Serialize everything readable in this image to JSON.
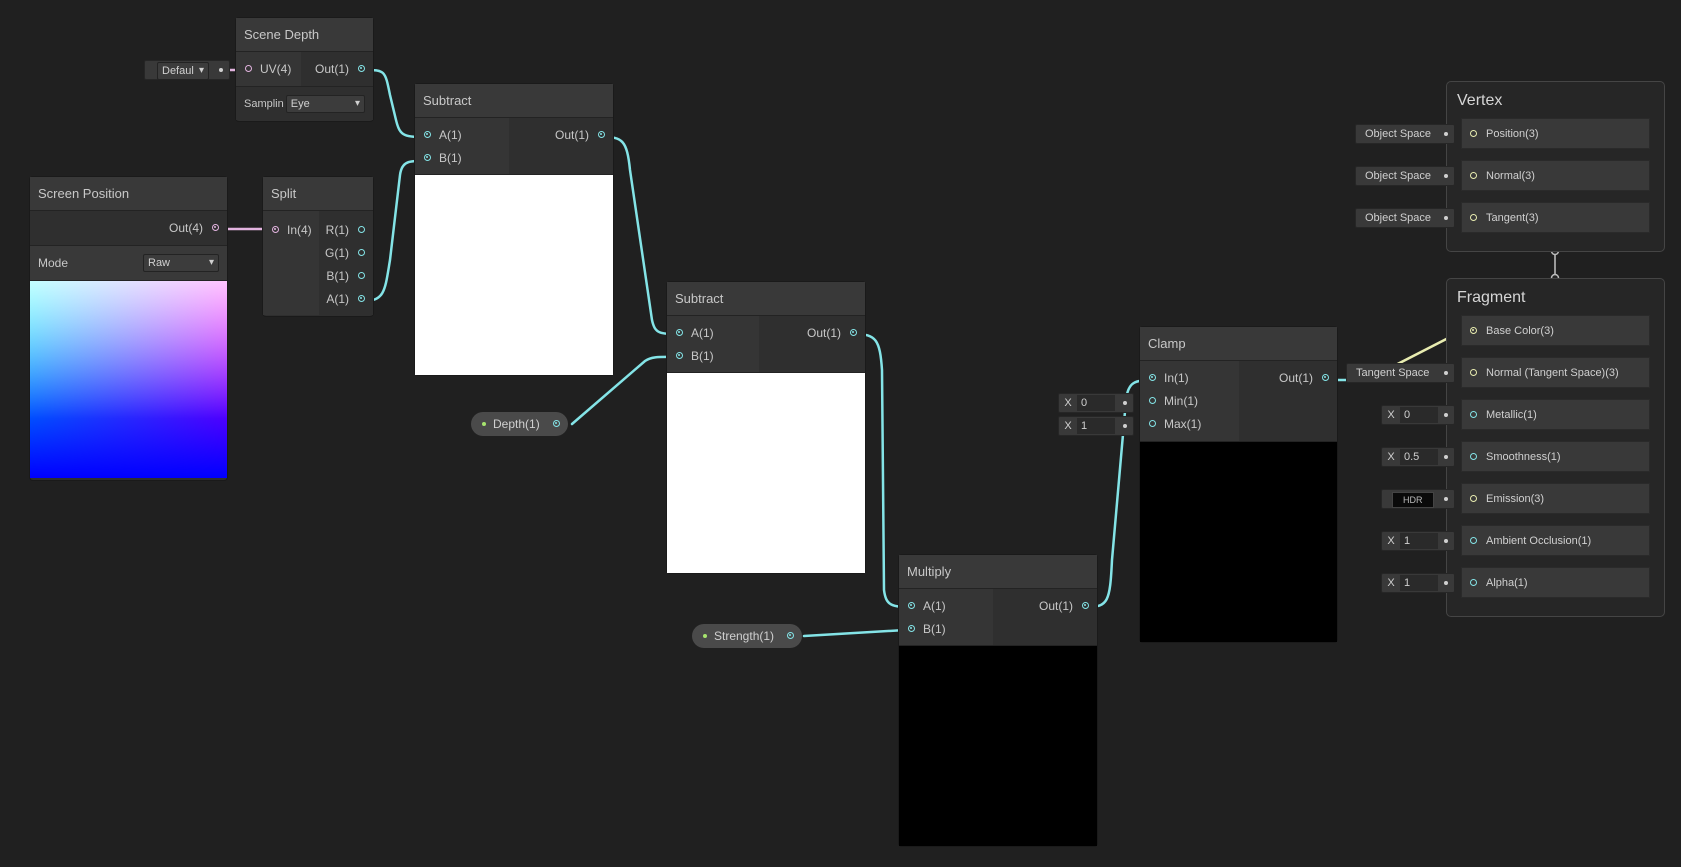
{
  "colors": {
    "float_wire": "#84e4e7",
    "vec4_wire": "#e3b4e0",
    "vec3_wire": "#e8ecb0",
    "background": "#202020"
  },
  "scene_depth": {
    "title": "Scene Depth",
    "uv_port": "UV(4)",
    "out_port": "Out(1)",
    "uv_dropdown": "Defaul",
    "sampling_label": "Samplin",
    "sampling_value": "Eye"
  },
  "screen_position": {
    "title": "Screen Position",
    "out_port": "Out(4)",
    "mode_label": "Mode",
    "mode_value": "Raw"
  },
  "split": {
    "title": "Split",
    "in_port": "In(4)",
    "outputs": [
      "R(1)",
      "G(1)",
      "B(1)",
      "A(1)"
    ]
  },
  "subtract1": {
    "title": "Subtract",
    "inputs": [
      "A(1)",
      "B(1)"
    ],
    "out_port": "Out(1)"
  },
  "subtract2": {
    "title": "Subtract",
    "inputs": [
      "A(1)",
      "B(1)"
    ],
    "out_port": "Out(1)"
  },
  "depth_property": {
    "label": "Depth(1)"
  },
  "strength_property": {
    "label": "Strength(1)"
  },
  "multiply": {
    "title": "Multiply",
    "inputs": [
      "A(1)",
      "B(1)"
    ],
    "out_port": "Out(1)"
  },
  "clamp": {
    "title": "Clamp",
    "inputs": [
      "In(1)",
      "Min(1)",
      "Max(1)"
    ],
    "out_port": "Out(1)",
    "min_axis": "X",
    "min_value": "0",
    "max_axis": "X",
    "max_value": "1"
  },
  "vertex": {
    "title": "Vertex",
    "slots": [
      {
        "label": "Position(3)",
        "space": "Object Space"
      },
      {
        "label": "Normal(3)",
        "space": "Object Space"
      },
      {
        "label": "Tangent(3)",
        "space": "Object Space"
      }
    ]
  },
  "fragment": {
    "title": "Fragment",
    "base_color": "Base Color(3)",
    "normal": "Normal (Tangent Space)(3)",
    "normal_space": "Tangent Space",
    "metallic": "Metallic(1)",
    "metallic_axis": "X",
    "metallic_value": "0",
    "smoothness": "Smoothness(1)",
    "smoothness_axis": "X",
    "smoothness_value": "0.5",
    "emission": "Emission(3)",
    "emission_badge": "HDR",
    "ao": "Ambient Occlusion(1)",
    "ao_axis": "X",
    "ao_value": "1",
    "alpha": "Alpha(1)",
    "alpha_axis": "X",
    "alpha_value": "1"
  }
}
